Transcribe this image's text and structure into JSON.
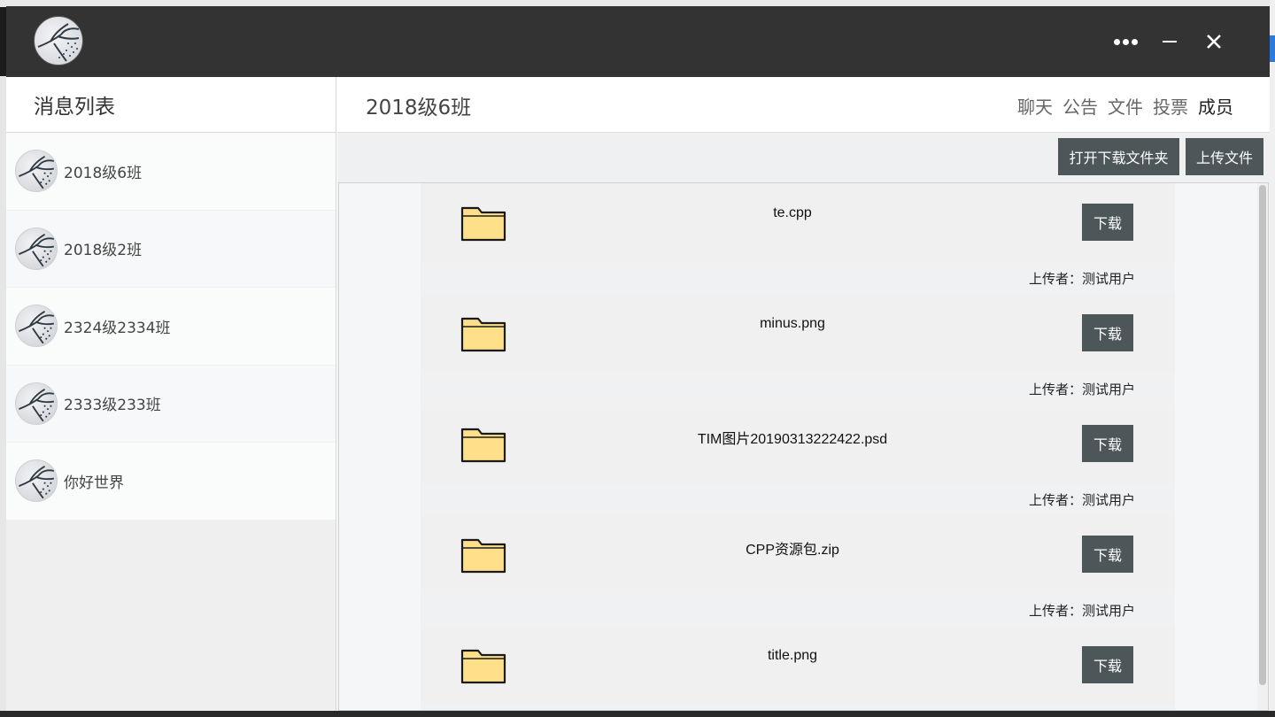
{
  "window": {
    "controls": [
      "more-options",
      "minimize",
      "close"
    ]
  },
  "sidebar": {
    "title": "消息列表",
    "conversations": [
      {
        "name": "2018级6班"
      },
      {
        "name": "2018级2班"
      },
      {
        "name": "2324级2334班"
      },
      {
        "name": "2333级233班"
      },
      {
        "name": "你好世界"
      }
    ]
  },
  "chat": {
    "title": "2018级6班",
    "tabs": [
      {
        "label": "聊天"
      },
      {
        "label": "公告"
      },
      {
        "label": "文件"
      },
      {
        "label": "投票"
      },
      {
        "label": "成员",
        "active": true
      }
    ]
  },
  "files": {
    "open_folder_label": "打开下载文件夹",
    "upload_label": "上传文件",
    "items": [
      {
        "name": "te.cpp",
        "download_label": "下载",
        "uploader": "上传者：测试用户"
      },
      {
        "name": "minus.png",
        "download_label": "下载",
        "uploader": "上传者：测试用户"
      },
      {
        "name": "TIM图片20190313222422.psd",
        "download_label": "下载",
        "uploader": "上传者：测试用户"
      },
      {
        "name": "CPP资源包.zip",
        "download_label": "下载",
        "uploader": "上传者：测试用户"
      },
      {
        "name": "title.png",
        "download_label": "下载",
        "uploader": ""
      }
    ]
  },
  "colors": {
    "titlebar": "#333333",
    "button_dark": "#4d5759",
    "folder_fill": "#ffe08a",
    "folder_stroke": "#1a1a1a"
  }
}
